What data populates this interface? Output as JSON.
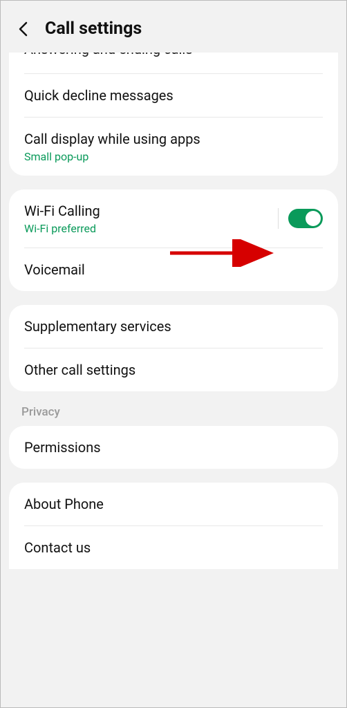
{
  "header": {
    "title": "Call settings"
  },
  "group1": {
    "item0": {
      "label": "Answering and ending calls"
    },
    "item1": {
      "label": "Quick decline messages"
    },
    "item2": {
      "label": "Call display while using apps",
      "sub": "Small pop-up"
    }
  },
  "group2": {
    "item0": {
      "label": "Wi-Fi Calling",
      "sub": "Wi-Fi preferred",
      "toggle": true
    },
    "item1": {
      "label": "Voicemail"
    }
  },
  "group3": {
    "item0": {
      "label": "Supplementary services"
    },
    "item1": {
      "label": "Other call settings"
    }
  },
  "section_privacy": "Privacy",
  "group4": {
    "item0": {
      "label": "Permissions"
    }
  },
  "group5": {
    "item0": {
      "label": "About Phone"
    },
    "item1": {
      "label": "Contact us"
    }
  }
}
